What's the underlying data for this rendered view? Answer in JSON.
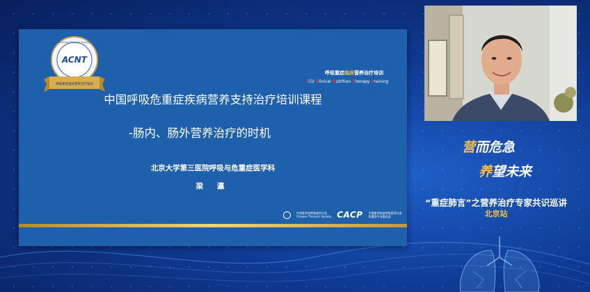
{
  "slide": {
    "badge_text": "ACNT",
    "badge_ribbon": "呼吸重症临床营养治疗培训",
    "badge_ring": "Nutrition Therapy Training",
    "brand_cn_pre": "呼吸重症",
    "brand_cn_hl": "临床",
    "brand_cn_post": "营养治疗培训",
    "brand_en": [
      {
        "cap": "I",
        "rest": "CU "
      },
      {
        "cap": "C",
        "rest": "linical "
      },
      {
        "cap": "N",
        "rest": "utrition "
      },
      {
        "cap": "T",
        "rest": "herapy "
      },
      {
        "cap": "T",
        "rest": "raining"
      }
    ],
    "title_line1": "中国呼吸危重症疾病营养支持治疗培训课程",
    "title_line2": "-肠内、肠外营养治疗的时机",
    "institute": "北京大学第三医院呼吸与危重症医学科",
    "speaker": "梁 瀛",
    "logo1_cn": "中华医学会呼吸病学分会",
    "logo1_en": "Chinese Thoracic Society",
    "logo2_name": "CACP",
    "logo2_cn1": "中国医师协会呼吸医师分会",
    "logo2_cn2": "危重症专业委员会"
  },
  "branding": {
    "slogan1_a": "营",
    "slogan1_b": "而危急",
    "slogan2_a": "养",
    "slogan2_b": "望未来",
    "event_title": "“重症肺言”之营养治疗专家共识巡讲",
    "event_sub": "北京站"
  },
  "colors": {
    "slide_bg": "#1f60ac",
    "gold": "#f0c14b",
    "background": "#0f3a93"
  }
}
